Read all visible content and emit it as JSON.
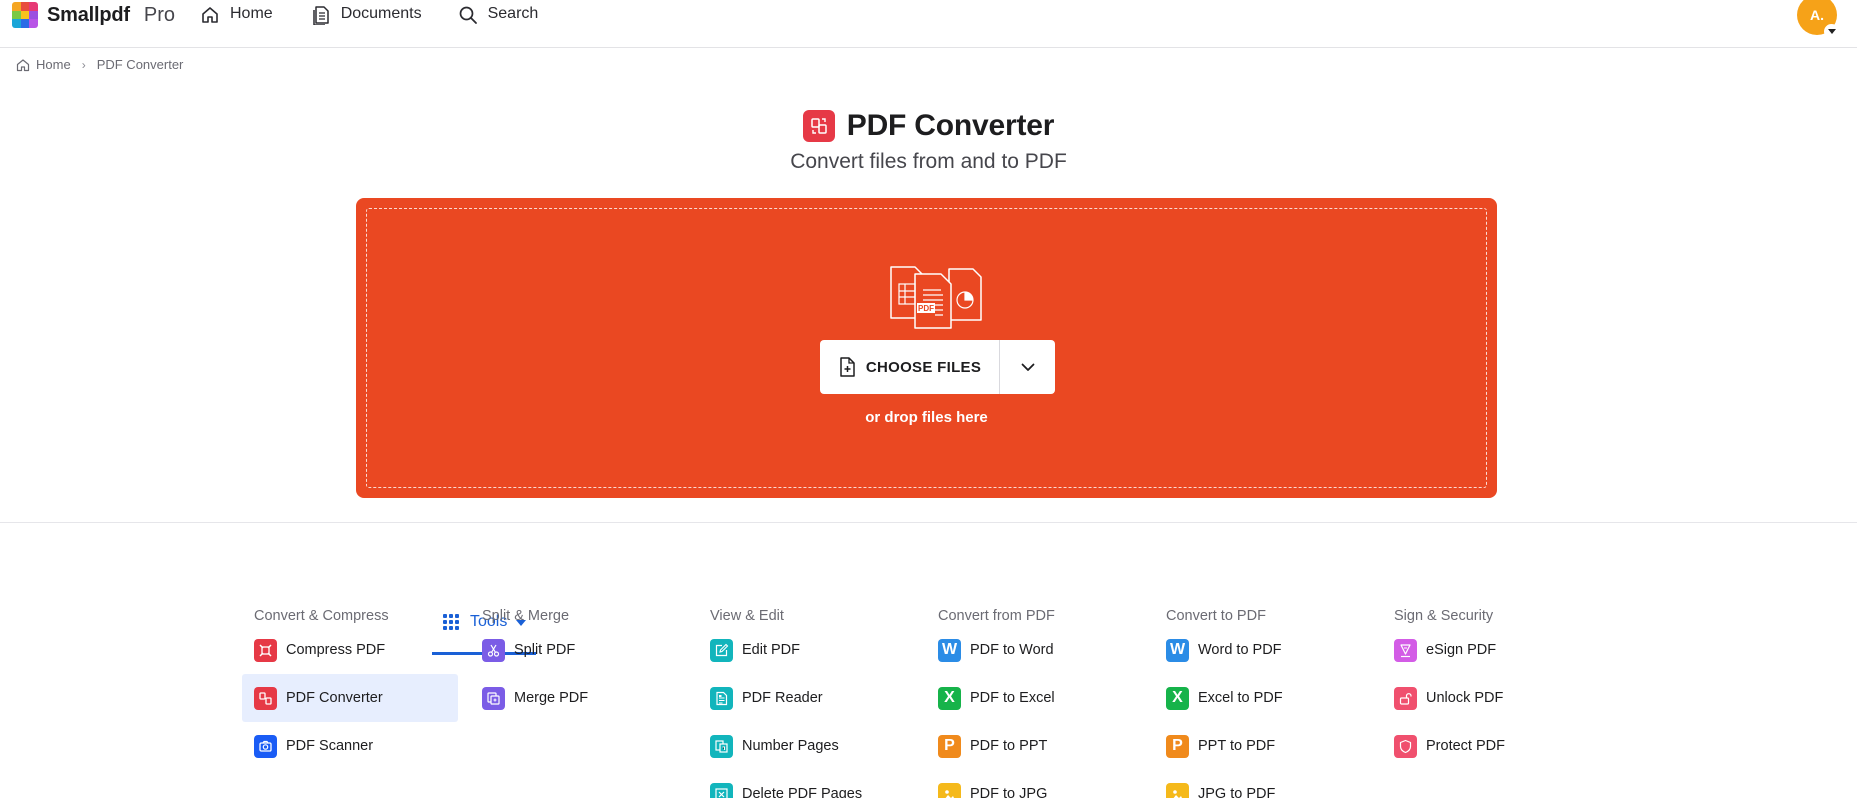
{
  "header": {
    "brand_name": "Smallpdf",
    "brand_tier": "Pro",
    "nav": [
      {
        "label": "Home"
      },
      {
        "label": "Tools"
      },
      {
        "label": "Documents"
      },
      {
        "label": "Search"
      }
    ],
    "avatar_initials": "A."
  },
  "breadcrumb": {
    "home": "Home",
    "current": "PDF Converter"
  },
  "page": {
    "title": "PDF Converter",
    "subtitle": "Convert files from and to PDF"
  },
  "dropzone": {
    "art_label": "PDF",
    "choose_label": "CHOOSE FILES",
    "hint": "or drop files here"
  },
  "colors": {
    "accent": "#1a60d6",
    "dropzone": "#ea4822",
    "active_row": "#e7eefe"
  },
  "tool_columns": [
    {
      "heading": "Convert & Compress",
      "items": [
        {
          "label": "Compress PDF",
          "icon": "compress-icon",
          "color": "#e63946"
        },
        {
          "label": "PDF Converter",
          "icon": "convert-icon",
          "color": "#e63946",
          "active": true
        },
        {
          "label": "PDF Scanner",
          "icon": "scanner-icon",
          "color": "#1a5cf5"
        }
      ]
    },
    {
      "heading": "Split & Merge",
      "items": [
        {
          "label": "Split PDF",
          "icon": "scissors-icon",
          "color": "#7b5ce6"
        },
        {
          "label": "Merge PDF",
          "icon": "merge-icon",
          "color": "#7b5ce6"
        }
      ]
    },
    {
      "heading": "View & Edit",
      "items": [
        {
          "label": "Edit PDF",
          "icon": "edit-icon",
          "color": "#12b5bc"
        },
        {
          "label": "PDF Reader",
          "icon": "reader-icon",
          "color": "#12b5bc"
        },
        {
          "label": "Number Pages",
          "icon": "number-pages-icon",
          "color": "#12b5bc"
        },
        {
          "label": "Delete PDF Pages",
          "icon": "delete-pages-icon",
          "color": "#12b5bc"
        }
      ]
    },
    {
      "heading": "Convert from PDF",
      "items": [
        {
          "label": "PDF to Word",
          "icon": "word-icon",
          "glyph": "W",
          "color": "#2b8ce6"
        },
        {
          "label": "PDF to Excel",
          "icon": "excel-icon",
          "glyph": "X",
          "color": "#16b34a"
        },
        {
          "label": "PDF to PPT",
          "icon": "ppt-icon",
          "glyph": "P",
          "color": "#f08a1c"
        },
        {
          "label": "PDF to JPG",
          "icon": "jpg-icon",
          "color": "#f5b91b"
        }
      ]
    },
    {
      "heading": "Convert to PDF",
      "items": [
        {
          "label": "Word to PDF",
          "icon": "word-icon",
          "glyph": "W",
          "color": "#2b8ce6"
        },
        {
          "label": "Excel to PDF",
          "icon": "excel-icon",
          "glyph": "X",
          "color": "#16b34a"
        },
        {
          "label": "PPT to PDF",
          "icon": "ppt-icon",
          "glyph": "P",
          "color": "#f08a1c"
        },
        {
          "label": "JPG to PDF",
          "icon": "jpg-icon",
          "color": "#f5b91b"
        }
      ]
    },
    {
      "heading": "Sign & Security",
      "items": [
        {
          "label": "eSign PDF",
          "icon": "esign-icon",
          "color": "#d35ce6"
        },
        {
          "label": "Unlock PDF",
          "icon": "unlock-icon",
          "color": "#f0506e"
        },
        {
          "label": "Protect PDF",
          "icon": "protect-icon",
          "color": "#f0506e"
        }
      ]
    }
  ]
}
